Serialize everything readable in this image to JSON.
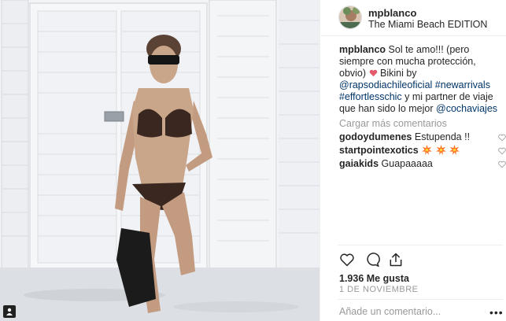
{
  "post": {
    "username": "mpblanco",
    "location": "The Miami Beach EDITION"
  },
  "caption": {
    "username": "mpblanco",
    "text1": "Sol te amo!!! (pero siempre con mucha protección, obvio)",
    "emoji_icon": "smiling-face-with-heart-eyes-icon",
    "text2": "Bikini by",
    "mention1": "@rapsodiachileoficial",
    "hashtag1": "#newarrivals",
    "hashtag2": "#effortlesschic",
    "text3": "y mi partner de viaje que han sido lo mejor",
    "mention2": "@cochaviajes"
  },
  "load_more": "Cargar más comentarios",
  "comments": [
    {
      "username": "godoydumenes",
      "text": "Estupenda !!"
    },
    {
      "username": "startpointexotics",
      "text": "",
      "emoji_icons": [
        "collision-icon",
        "collision-icon",
        "collision-icon"
      ]
    },
    {
      "username": "gaiakids",
      "text": "Guapaaaaa"
    }
  ],
  "stats": {
    "likes": "1.936 Me gusta",
    "date": "1 DE NOVIEMBRE"
  },
  "comment_box": {
    "placeholder": "Añade un comentario...",
    "more_label": "•••"
  },
  "colors": {
    "link": "#003569",
    "text": "#262626",
    "muted": "#999999",
    "divider": "#efefef"
  }
}
